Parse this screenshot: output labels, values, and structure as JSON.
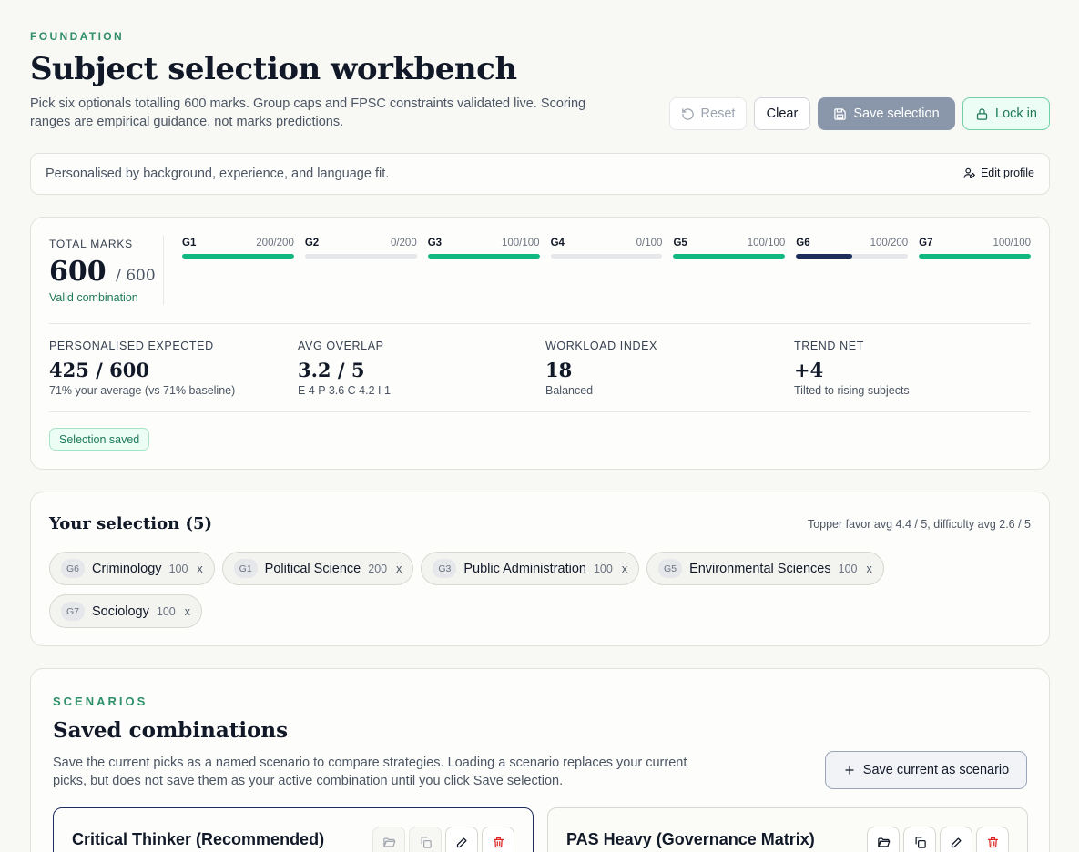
{
  "header": {
    "eyebrow": "FOUNDATION",
    "title": "Subject selection workbench",
    "subtitle": "Pick six optionals totalling 600 marks. Group caps and FPSC constraints validated live. Scoring ranges are empirical guidance, not marks predictions."
  },
  "toolbar": {
    "reset_label": "Reset",
    "clear_label": "Clear",
    "save_label": "Save selection",
    "lock_label": "Lock in"
  },
  "profile": {
    "text": "Personalised by background, experience, and language fit.",
    "edit_label": "Edit profile"
  },
  "totals": {
    "label": "TOTAL MARKS",
    "value": "600",
    "max": "/ 600",
    "status": "Valid combination",
    "groups": [
      {
        "name": "G1",
        "value": "200/200",
        "fill": 1.0,
        "color": "#10b981"
      },
      {
        "name": "G2",
        "value": "0/200",
        "fill": 0.0,
        "color": "#10b981"
      },
      {
        "name": "G3",
        "value": "100/100",
        "fill": 1.0,
        "color": "#10b981"
      },
      {
        "name": "G4",
        "value": "0/100",
        "fill": 0.0,
        "color": "#10b981"
      },
      {
        "name": "G5",
        "value": "100/100",
        "fill": 1.0,
        "color": "#10b981"
      },
      {
        "name": "G6",
        "value": "100/200",
        "fill": 0.5,
        "color": "#1e2e5c"
      },
      {
        "name": "G7",
        "value": "100/100",
        "fill": 1.0,
        "color": "#10b981"
      }
    ],
    "metrics": [
      {
        "label": "PERSONALISED EXPECTED",
        "value": "425 / 600",
        "sub": "71% your average (vs 71% baseline)"
      },
      {
        "label": "AVG OVERLAP",
        "value": "3.2 / 5",
        "sub": "E 4 P 3.6 C 4.2 I 1"
      },
      {
        "label": "WORKLOAD INDEX",
        "value": "18",
        "sub": "Balanced"
      },
      {
        "label": "TREND NET",
        "value": "+4",
        "sub": "Tilted to rising subjects"
      }
    ],
    "saved_badge": "Selection saved"
  },
  "selection": {
    "title": "Your selection (5)",
    "meta": "Topper favor avg 4.4 / 5, difficulty avg 2.6 / 5",
    "chips": [
      {
        "group": "G6",
        "name": "Criminology",
        "marks": "100",
        "remove": "x"
      },
      {
        "group": "G1",
        "name": "Political Science",
        "marks": "200",
        "remove": "x"
      },
      {
        "group": "G3",
        "name": "Public Administration",
        "marks": "100",
        "remove": "x"
      },
      {
        "group": "G5",
        "name": "Environmental Sciences",
        "marks": "100",
        "remove": "x"
      },
      {
        "group": "G7",
        "name": "Sociology",
        "marks": "100",
        "remove": "x"
      }
    ]
  },
  "scenarios": {
    "eyebrow": "SCENARIOS",
    "title": "Saved combinations",
    "description": "Save the current picks as a named scenario to compare strategies. Loading a scenario replaces your current picks, but does not save them as your active combination until you click Save selection.",
    "save_label": "Save current as scenario",
    "items": [
      {
        "name": "Critical Thinker (Recommended)"
      },
      {
        "name": "PAS Heavy (Governance Matrix)"
      }
    ]
  },
  "colors": {
    "accent_green": "#10b981",
    "accent_navy": "#1e2e5c",
    "danger": "#dc2626"
  }
}
